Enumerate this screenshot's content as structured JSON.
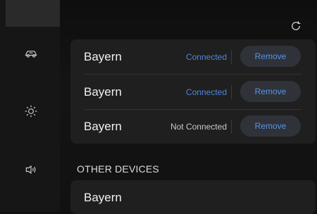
{
  "sidebar": {
    "icons": [
      "car-icon",
      "brightness-icon",
      "volume-icon"
    ]
  },
  "header": {
    "refresh_icon": "refresh-icon"
  },
  "paired_devices": [
    {
      "name": "Bayern",
      "status": "Connected",
      "remove_label": "Remove"
    },
    {
      "name": "Bayern",
      "status": "Connected",
      "remove_label": "Remove"
    },
    {
      "name": "Bayern",
      "status": "Not Connected",
      "remove_label": "Remove"
    }
  ],
  "other_devices": {
    "title": "OTHER DEVICES",
    "items": [
      {
        "name": "Bayern"
      }
    ]
  },
  "colors": {
    "accent": "#4d86d8",
    "button_bg": "#2f3238",
    "card_bg": "#1f1f1f"
  }
}
